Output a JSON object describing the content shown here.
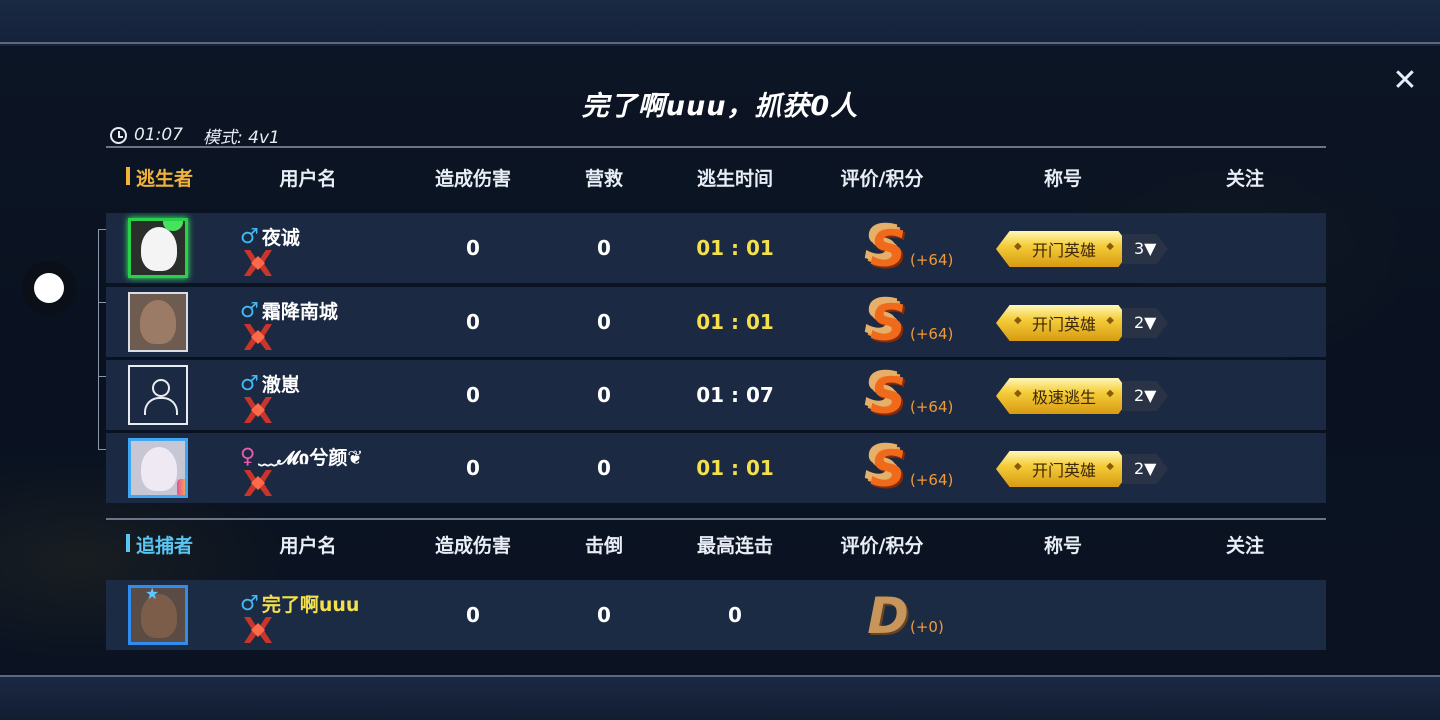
{
  "title": "完了啊uuu，抓获0人",
  "meta": {
    "time": "01:07",
    "mode": "模式: 4v1"
  },
  "close_icon": "✕",
  "escapers": {
    "headers": {
      "role": "逃生者",
      "username": "用户名",
      "damage": "造成伤害",
      "rescue": "营救",
      "escape_time": "逃生时间",
      "rating": "评价/积分",
      "title": "称号",
      "follow": "关注"
    },
    "rows": [
      {
        "gender": "♂",
        "name": "夜诚",
        "damage": "0",
        "rescue": "0",
        "time": "01 : 01",
        "grade": "S",
        "score": "(+64)",
        "title": "开门英雄",
        "title_level": "3▼",
        "avatar": "avatar-green-frame"
      },
      {
        "gender": "♂",
        "name": "霜降南城",
        "damage": "0",
        "rescue": "0",
        "time": "01 : 01",
        "grade": "S",
        "score": "(+64)",
        "title": "开门英雄",
        "title_level": "2▼",
        "avatar": "avatar-portrait"
      },
      {
        "gender": "♂",
        "name": "澈崽",
        "damage": "0",
        "rescue": "0",
        "time": "01 : 07",
        "grade": "S",
        "score": "(+64)",
        "title": "极速逃生",
        "title_level": "2▼",
        "avatar": "default-person-icon"
      },
      {
        "gender": "♀",
        "name": "﹏𝓜ი兮颜❦",
        "damage": "0",
        "rescue": "0",
        "time": "01 : 01",
        "grade": "S",
        "score": "(+64)",
        "title": "开门英雄",
        "title_level": "2▼",
        "avatar": "avatar-blue-frame"
      }
    ]
  },
  "hunters": {
    "headers": {
      "role": "追捕者",
      "username": "用户名",
      "damage": "造成伤害",
      "knockdown": "击倒",
      "combo": "最高连击",
      "rating": "评价/积分",
      "title": "称号",
      "follow": "关注"
    },
    "rows": [
      {
        "gender": "♂",
        "name": "完了啊uuu",
        "damage": "0",
        "knockdown": "0",
        "combo": "0",
        "grade": "D",
        "score": "(+0)",
        "avatar": "avatar-star-frame"
      }
    ]
  },
  "colors": {
    "escaper_accent": "#f1b33c",
    "hunter_accent": "#59c6f2",
    "highlight_time": "#f4e04d",
    "score": "#f09a3a",
    "grade_s": "#f06a1c",
    "grade_d": "#c8965a"
  }
}
